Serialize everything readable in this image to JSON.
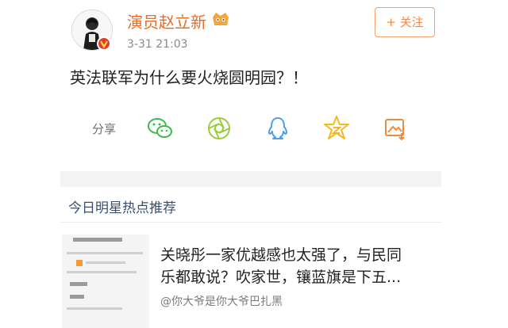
{
  "post": {
    "username": "演员赵立新",
    "time": "3-31 21:03",
    "follow_label": "+ 关注",
    "text": "英法联军为什么要火烧圆明园？！"
  },
  "share": {
    "label": "分享",
    "targets": [
      "wechat-icon",
      "moments-icon",
      "qq-icon",
      "qzone-icon",
      "save-image-icon"
    ]
  },
  "recommend": {
    "title": "今日明星热点推荐",
    "item": {
      "title_line1": "关晓彤一家优越感也太强了，与民同",
      "title_line2": "乐都敢说？吹家世，镶蓝旗是下五...",
      "source": "@你大爷是你大爷巴扎黑"
    }
  },
  "colors": {
    "username": "#eb6b22",
    "follow": "#f0894a",
    "icon_green": "#3dbb4a",
    "icon_blue": "#4aa0ea",
    "icon_yellow": "#f5b91c",
    "section_title": "#3a4f6e"
  }
}
